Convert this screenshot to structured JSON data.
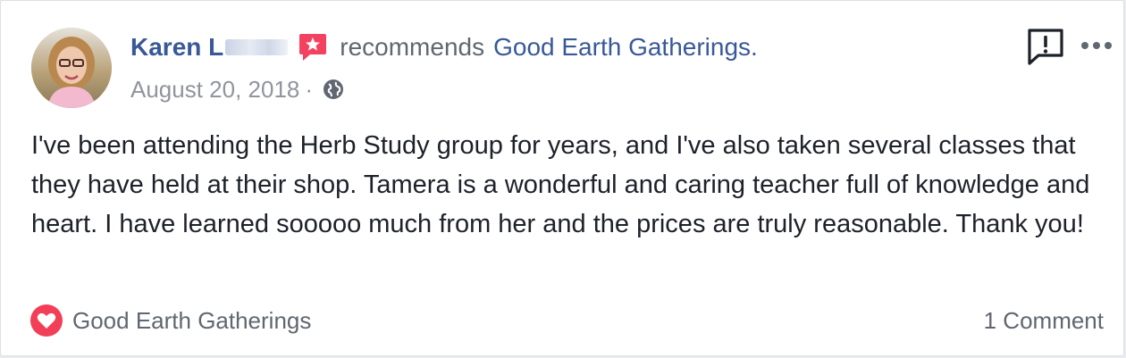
{
  "post": {
    "author_name": "Karen L",
    "action_text": "recommends",
    "page_name": "Good Earth Gatherings.",
    "date": "August 20, 2018",
    "separator": "·",
    "privacy_icon": "globe-icon",
    "body": "I've been attending the Herb Study group for years, and I've also taken several classes that they have held at their shop. Tamera is a wonderful and caring teacher full of knowledge and heart. I have learned sooooo much from her and the prices are truly reasonable. Thank you!"
  },
  "footer": {
    "reaction_icon": "heart-icon",
    "reaction_label": "Good Earth Gatherings",
    "comments_label": "1 Comment"
  },
  "icons": {
    "badge": "recommendation-star-icon",
    "report": "report-icon",
    "more": "more-options-icon"
  },
  "colors": {
    "link_blue": "#385898",
    "badge_red": "#f3425f",
    "heart_red": "#f33e58",
    "text": "#1d2129",
    "muted": "#90949c"
  }
}
